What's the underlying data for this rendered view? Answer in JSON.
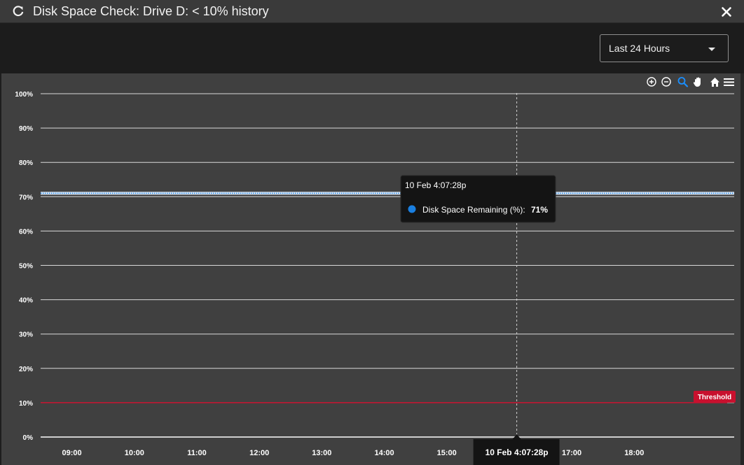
{
  "window": {
    "title": "Disk Space Check: Drive D: < 10% history",
    "refresh_icon": "refresh-icon",
    "close_icon": "close-icon"
  },
  "toolbar": {
    "range_select": {
      "value": "Last 24 Hours",
      "icon": "chevron-down-icon"
    }
  },
  "chart_toolbar": {
    "icons": [
      "zoom-in-icon",
      "zoom-out-icon",
      "magnifier-icon",
      "pan-hand-icon",
      "home-icon",
      "menu-icon"
    ],
    "active_icon": "magnifier-icon"
  },
  "colors": {
    "series": "#1a7fe0",
    "threshold": "#c8102e",
    "chart_bg": "#404040",
    "grid": "#d9d9d9"
  },
  "chart_data": {
    "type": "line",
    "ylim": [
      0,
      100
    ],
    "y_ticks": [
      "0%",
      "10%",
      "20%",
      "30%",
      "40%",
      "50%",
      "60%",
      "70%",
      "80%",
      "90%",
      "100%"
    ],
    "x_ticks": [
      "09:00",
      "10:00",
      "11:00",
      "12:00",
      "13:00",
      "14:00",
      "15:00",
      "16:00",
      "17:00",
      "18:00"
    ],
    "x_range_hours": [
      8.5,
      19.6
    ],
    "grid": true,
    "series": [
      {
        "name": "Disk Space Remaining (%)",
        "color": "#1a7fe0",
        "x": [
          8.5,
          9,
          10,
          11,
          12,
          13,
          14,
          15,
          16,
          16.12,
          17,
          18,
          19,
          19.6
        ],
        "y": [
          71,
          71,
          71,
          71,
          71,
          71,
          71,
          71,
          71,
          71,
          71,
          71,
          71,
          71
        ]
      }
    ],
    "threshold": {
      "label": "Threshold",
      "value": 10
    },
    "tooltip": {
      "time": "10 Feb 4:07:28p",
      "series_label": "Disk Space Remaining (%):",
      "value": "71%",
      "x": 16.12,
      "y": 71
    },
    "crosshair_label": "10 Feb 4:07:28p"
  }
}
